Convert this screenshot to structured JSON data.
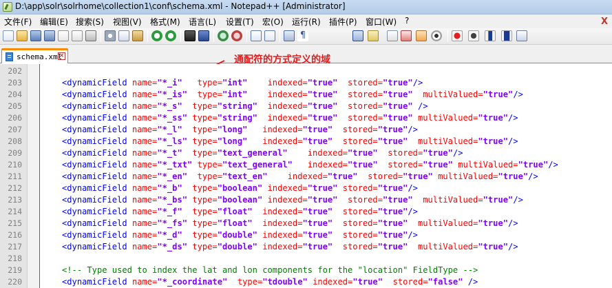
{
  "window": {
    "title": "D:\\app\\solr\\solrhome\\collection1\\conf\\schema.xml - Notepad++ [Administrator]"
  },
  "menu": {
    "items": [
      "文件(F)",
      "编辑(E)",
      "搜索(S)",
      "视图(V)",
      "格式(M)",
      "语言(L)",
      "设置(T)",
      "宏(O)",
      "运行(R)",
      "插件(P)",
      "窗口(W)",
      "?"
    ],
    "close_label": "X"
  },
  "toolbar": {
    "buttons": [
      "new-file",
      "open-file",
      "save",
      "save-all",
      "close",
      "close-all",
      "print",
      "cut",
      "copy",
      "paste",
      "undo",
      "redo",
      "find",
      "replace",
      "zoom-in",
      "zoom-out",
      "sync-vertical",
      "sync-horizontal",
      "word-wrap",
      "show-all-chars",
      "indent-guide",
      "user-defined-language",
      "doc-map",
      "function-list",
      "folder-as-workspace",
      "monitoring",
      "record-macro",
      "stop-recording",
      "play-macro",
      "run-macro-multiple",
      "save-macro"
    ]
  },
  "tabs": [
    {
      "label": "schema.xml",
      "active": true,
      "close_symbol": "×"
    }
  ],
  "annotation": {
    "text": "通配符的方式定义的域",
    "color": "#e02020"
  },
  "editor": {
    "lines": [
      {
        "num": "202",
        "tokens": []
      },
      {
        "num": "203",
        "tokens": [
          [
            "tag",
            "<dynamicField "
          ],
          [
            "attr",
            "name="
          ],
          [
            "val",
            "\"*_i\""
          ],
          [
            "tag",
            "   "
          ],
          [
            "attr",
            "type="
          ],
          [
            "val",
            "\"int\""
          ],
          [
            "tag",
            "    "
          ],
          [
            "attr",
            "indexed="
          ],
          [
            "val",
            "\"true\""
          ],
          [
            "tag",
            "  "
          ],
          [
            "attr",
            "stored="
          ],
          [
            "val",
            "\"true\""
          ],
          [
            "tag",
            "/>"
          ]
        ]
      },
      {
        "num": "204",
        "tokens": [
          [
            "tag",
            "<dynamicField "
          ],
          [
            "attr",
            "name="
          ],
          [
            "val",
            "\"*_is\""
          ],
          [
            "tag",
            "  "
          ],
          [
            "attr",
            "type="
          ],
          [
            "val",
            "\"int\""
          ],
          [
            "tag",
            "    "
          ],
          [
            "attr",
            "indexed="
          ],
          [
            "val",
            "\"true\""
          ],
          [
            "tag",
            "  "
          ],
          [
            "attr",
            "stored="
          ],
          [
            "val",
            "\"true\""
          ],
          [
            "tag",
            "  "
          ],
          [
            "attr",
            "multiValued="
          ],
          [
            "val",
            "\"true\""
          ],
          [
            "tag",
            "/>"
          ]
        ]
      },
      {
        "num": "205",
        "tokens": [
          [
            "tag",
            "<dynamicField "
          ],
          [
            "attr",
            "name="
          ],
          [
            "val",
            "\"*_s\""
          ],
          [
            "tag",
            "  "
          ],
          [
            "attr",
            "type="
          ],
          [
            "val",
            "\"string\""
          ],
          [
            "tag",
            "  "
          ],
          [
            "attr",
            "indexed="
          ],
          [
            "val",
            "\"true\""
          ],
          [
            "tag",
            "  "
          ],
          [
            "attr",
            "stored="
          ],
          [
            "val",
            "\"true\""
          ],
          [
            "tag",
            " />"
          ]
        ]
      },
      {
        "num": "206",
        "tokens": [
          [
            "tag",
            "<dynamicField "
          ],
          [
            "attr",
            "name="
          ],
          [
            "val",
            "\"*_ss\""
          ],
          [
            "tag",
            " "
          ],
          [
            "attr",
            "type="
          ],
          [
            "val",
            "\"string\""
          ],
          [
            "tag",
            "  "
          ],
          [
            "attr",
            "indexed="
          ],
          [
            "val",
            "\"true\""
          ],
          [
            "tag",
            "  "
          ],
          [
            "attr",
            "stored="
          ],
          [
            "val",
            "\"true\""
          ],
          [
            "tag",
            " "
          ],
          [
            "attr",
            "multiValued="
          ],
          [
            "val",
            "\"true\""
          ],
          [
            "tag",
            "/>"
          ]
        ]
      },
      {
        "num": "207",
        "tokens": [
          [
            "tag",
            "<dynamicField "
          ],
          [
            "attr",
            "name="
          ],
          [
            "val",
            "\"*_l\""
          ],
          [
            "tag",
            "  "
          ],
          [
            "attr",
            "type="
          ],
          [
            "val",
            "\"long\""
          ],
          [
            "tag",
            "   "
          ],
          [
            "attr",
            "indexed="
          ],
          [
            "val",
            "\"true\""
          ],
          [
            "tag",
            "  "
          ],
          [
            "attr",
            "stored="
          ],
          [
            "val",
            "\"true\""
          ],
          [
            "tag",
            "/>"
          ]
        ]
      },
      {
        "num": "208",
        "tokens": [
          [
            "tag",
            "<dynamicField "
          ],
          [
            "attr",
            "name="
          ],
          [
            "val",
            "\"*_ls\""
          ],
          [
            "tag",
            " "
          ],
          [
            "attr",
            "type="
          ],
          [
            "val",
            "\"long\""
          ],
          [
            "tag",
            "   "
          ],
          [
            "attr",
            "indexed="
          ],
          [
            "val",
            "\"true\""
          ],
          [
            "tag",
            "  "
          ],
          [
            "attr",
            "stored="
          ],
          [
            "val",
            "\"true\""
          ],
          [
            "tag",
            "  "
          ],
          [
            "attr",
            "multiValued="
          ],
          [
            "val",
            "\"true\""
          ],
          [
            "tag",
            "/>"
          ]
        ]
      },
      {
        "num": "209",
        "tokens": [
          [
            "tag",
            "<dynamicField "
          ],
          [
            "attr",
            "name="
          ],
          [
            "val",
            "\"*_t\""
          ],
          [
            "tag",
            "  "
          ],
          [
            "attr",
            "type="
          ],
          [
            "val",
            "\"text_general\""
          ],
          [
            "tag",
            "    "
          ],
          [
            "attr",
            "indexed="
          ],
          [
            "val",
            "\"true\""
          ],
          [
            "tag",
            "  "
          ],
          [
            "attr",
            "stored="
          ],
          [
            "val",
            "\"true\""
          ],
          [
            "tag",
            "/>"
          ]
        ]
      },
      {
        "num": "210",
        "tokens": [
          [
            "tag",
            "<dynamicField "
          ],
          [
            "attr",
            "name="
          ],
          [
            "val",
            "\"*_txt\""
          ],
          [
            "tag",
            " "
          ],
          [
            "attr",
            "type="
          ],
          [
            "val",
            "\"text_general\""
          ],
          [
            "tag",
            "   "
          ],
          [
            "attr",
            "indexed="
          ],
          [
            "val",
            "\"true\""
          ],
          [
            "tag",
            "  "
          ],
          [
            "attr",
            "stored="
          ],
          [
            "val",
            "\"true\""
          ],
          [
            "tag",
            " "
          ],
          [
            "attr",
            "multiValued="
          ],
          [
            "val",
            "\"true\""
          ],
          [
            "tag",
            "/>"
          ]
        ]
      },
      {
        "num": "211",
        "tokens": [
          [
            "tag",
            "<dynamicField "
          ],
          [
            "attr",
            "name="
          ],
          [
            "val",
            "\"*_en\""
          ],
          [
            "tag",
            "  "
          ],
          [
            "attr",
            "type="
          ],
          [
            "val",
            "\"text_en\""
          ],
          [
            "tag",
            "    "
          ],
          [
            "attr",
            "indexed="
          ],
          [
            "val",
            "\"true\""
          ],
          [
            "tag",
            "  "
          ],
          [
            "attr",
            "stored="
          ],
          [
            "val",
            "\"true\""
          ],
          [
            "tag",
            " "
          ],
          [
            "attr",
            "multiValued="
          ],
          [
            "val",
            "\"true\""
          ],
          [
            "tag",
            "/>"
          ]
        ]
      },
      {
        "num": "212",
        "tokens": [
          [
            "tag",
            "<dynamicField "
          ],
          [
            "attr",
            "name="
          ],
          [
            "val",
            "\"*_b\""
          ],
          [
            "tag",
            "  "
          ],
          [
            "attr",
            "type="
          ],
          [
            "val",
            "\"boolean\""
          ],
          [
            "tag",
            " "
          ],
          [
            "attr",
            "indexed="
          ],
          [
            "val",
            "\"true\""
          ],
          [
            "tag",
            " "
          ],
          [
            "attr",
            "stored="
          ],
          [
            "val",
            "\"true\""
          ],
          [
            "tag",
            "/>"
          ]
        ]
      },
      {
        "num": "213",
        "tokens": [
          [
            "tag",
            "<dynamicField "
          ],
          [
            "attr",
            "name="
          ],
          [
            "val",
            "\"*_bs\""
          ],
          [
            "tag",
            " "
          ],
          [
            "attr",
            "type="
          ],
          [
            "val",
            "\"boolean\""
          ],
          [
            "tag",
            " "
          ],
          [
            "attr",
            "indexed="
          ],
          [
            "val",
            "\"true\""
          ],
          [
            "tag",
            "  "
          ],
          [
            "attr",
            "stored="
          ],
          [
            "val",
            "\"true\""
          ],
          [
            "tag",
            "  "
          ],
          [
            "attr",
            "multiValued="
          ],
          [
            "val",
            "\"true\""
          ],
          [
            "tag",
            "/>"
          ]
        ]
      },
      {
        "num": "214",
        "tokens": [
          [
            "tag",
            "<dynamicField "
          ],
          [
            "attr",
            "name="
          ],
          [
            "val",
            "\"*_f\""
          ],
          [
            "tag",
            "  "
          ],
          [
            "attr",
            "type="
          ],
          [
            "val",
            "\"float\""
          ],
          [
            "tag",
            "  "
          ],
          [
            "attr",
            "indexed="
          ],
          [
            "val",
            "\"true\""
          ],
          [
            "tag",
            "  "
          ],
          [
            "attr",
            "stored="
          ],
          [
            "val",
            "\"true\""
          ],
          [
            "tag",
            "/>"
          ]
        ]
      },
      {
        "num": "215",
        "tokens": [
          [
            "tag",
            "<dynamicField "
          ],
          [
            "attr",
            "name="
          ],
          [
            "val",
            "\"*_fs\""
          ],
          [
            "tag",
            " "
          ],
          [
            "attr",
            "type="
          ],
          [
            "val",
            "\"float\""
          ],
          [
            "tag",
            "  "
          ],
          [
            "attr",
            "indexed="
          ],
          [
            "val",
            "\"true\""
          ],
          [
            "tag",
            "  "
          ],
          [
            "attr",
            "stored="
          ],
          [
            "val",
            "\"true\""
          ],
          [
            "tag",
            "  "
          ],
          [
            "attr",
            "multiValued="
          ],
          [
            "val",
            "\"true\""
          ],
          [
            "tag",
            "/>"
          ]
        ]
      },
      {
        "num": "216",
        "tokens": [
          [
            "tag",
            "<dynamicField "
          ],
          [
            "attr",
            "name="
          ],
          [
            "val",
            "\"*_d\""
          ],
          [
            "tag",
            "  "
          ],
          [
            "attr",
            "type="
          ],
          [
            "val",
            "\"double\""
          ],
          [
            "tag",
            " "
          ],
          [
            "attr",
            "indexed="
          ],
          [
            "val",
            "\"true\""
          ],
          [
            "tag",
            "  "
          ],
          [
            "attr",
            "stored="
          ],
          [
            "val",
            "\"true\""
          ],
          [
            "tag",
            "/>"
          ]
        ]
      },
      {
        "num": "217",
        "tokens": [
          [
            "tag",
            "<dynamicField "
          ],
          [
            "attr",
            "name="
          ],
          [
            "val",
            "\"*_ds\""
          ],
          [
            "tag",
            " "
          ],
          [
            "attr",
            "type="
          ],
          [
            "val",
            "\"double\""
          ],
          [
            "tag",
            " "
          ],
          [
            "attr",
            "indexed="
          ],
          [
            "val",
            "\"true\""
          ],
          [
            "tag",
            "  "
          ],
          [
            "attr",
            "stored="
          ],
          [
            "val",
            "\"true\""
          ],
          [
            "tag",
            "  "
          ],
          [
            "attr",
            "multiValued="
          ],
          [
            "val",
            "\"true\""
          ],
          [
            "tag",
            "/>"
          ]
        ]
      },
      {
        "num": "218",
        "tokens": []
      },
      {
        "num": "219",
        "tokens": [
          [
            "comment",
            "<!-- Type used to index the lat and lon components for the \"location\" FieldType -->"
          ]
        ]
      },
      {
        "num": "220",
        "tokens": [
          [
            "tag",
            "<dynamicField "
          ],
          [
            "attr",
            "name="
          ],
          [
            "val",
            "\"*_coordinate\""
          ],
          [
            "tag",
            "  "
          ],
          [
            "attr",
            "type="
          ],
          [
            "val",
            "\"tdouble\""
          ],
          [
            "tag",
            " "
          ],
          [
            "attr",
            "indexed="
          ],
          [
            "val",
            "\"true\""
          ],
          [
            "tag",
            "  "
          ],
          [
            "attr",
            "stored="
          ],
          [
            "val",
            "\"false\""
          ],
          [
            "tag",
            " />"
          ]
        ]
      }
    ]
  },
  "colors": {
    "tag": "#0000ff",
    "attr": "#ff0000",
    "value": "#8000ff",
    "comment": "#008000",
    "tab_accent": "#fa8c00",
    "gutter": "#e4e4e4"
  }
}
